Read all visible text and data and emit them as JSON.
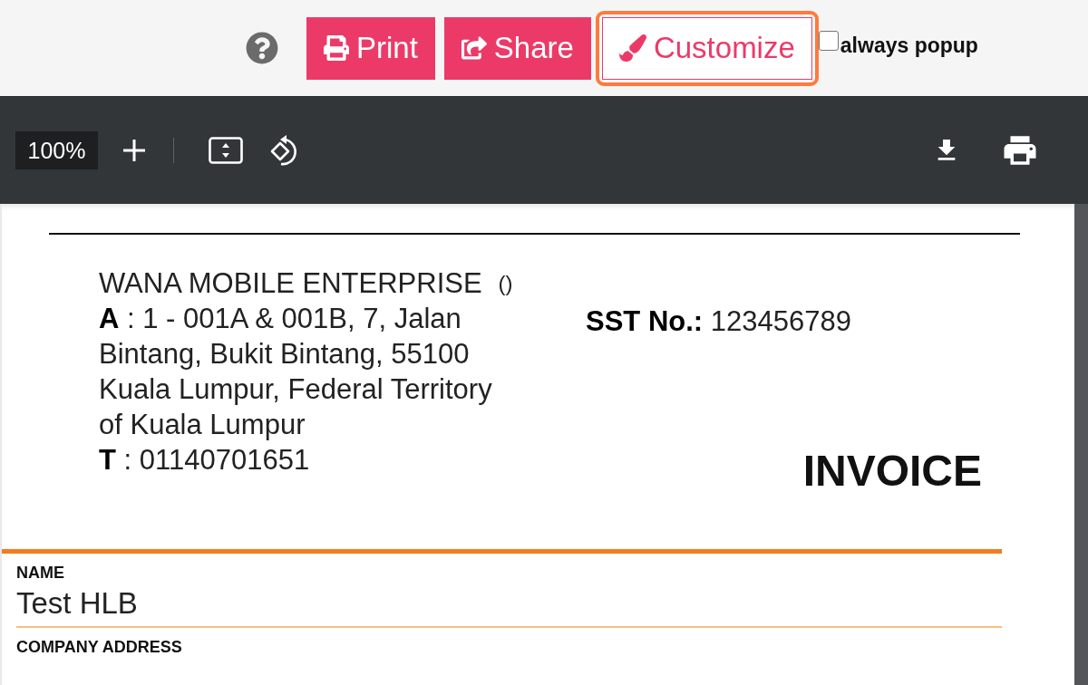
{
  "top_bar": {
    "buttons": [
      {
        "kind": "print",
        "label": "Print",
        "highlighted": false
      },
      {
        "kind": "share",
        "label": "Share",
        "highlighted": false
      },
      {
        "kind": "customize",
        "label": "Customize",
        "highlighted": true
      }
    ],
    "always_popup": {
      "label": "always popup",
      "checked": false
    }
  },
  "pdf_toolbar": {
    "zoom": "100%"
  },
  "document": {
    "company": {
      "name": "WANA MOBILE ENTERPRISE",
      "suffix": "()",
      "address": "**A** : 1 - 001A & 001B, 7, Jalan Bintang, Bukit Bintang, 55100 Kuala Lumpur, Federal Territory of Kuala Lumpur",
      "phone": "**T** : 01140701651"
    },
    "sst": "**SST No.:** 123456789",
    "title": "INVOICE",
    "fields": [
      {
        "label": "NAME",
        "value": "Test HLB"
      },
      {
        "label": "COMPANY ADDRESS"
      }
    ]
  }
}
